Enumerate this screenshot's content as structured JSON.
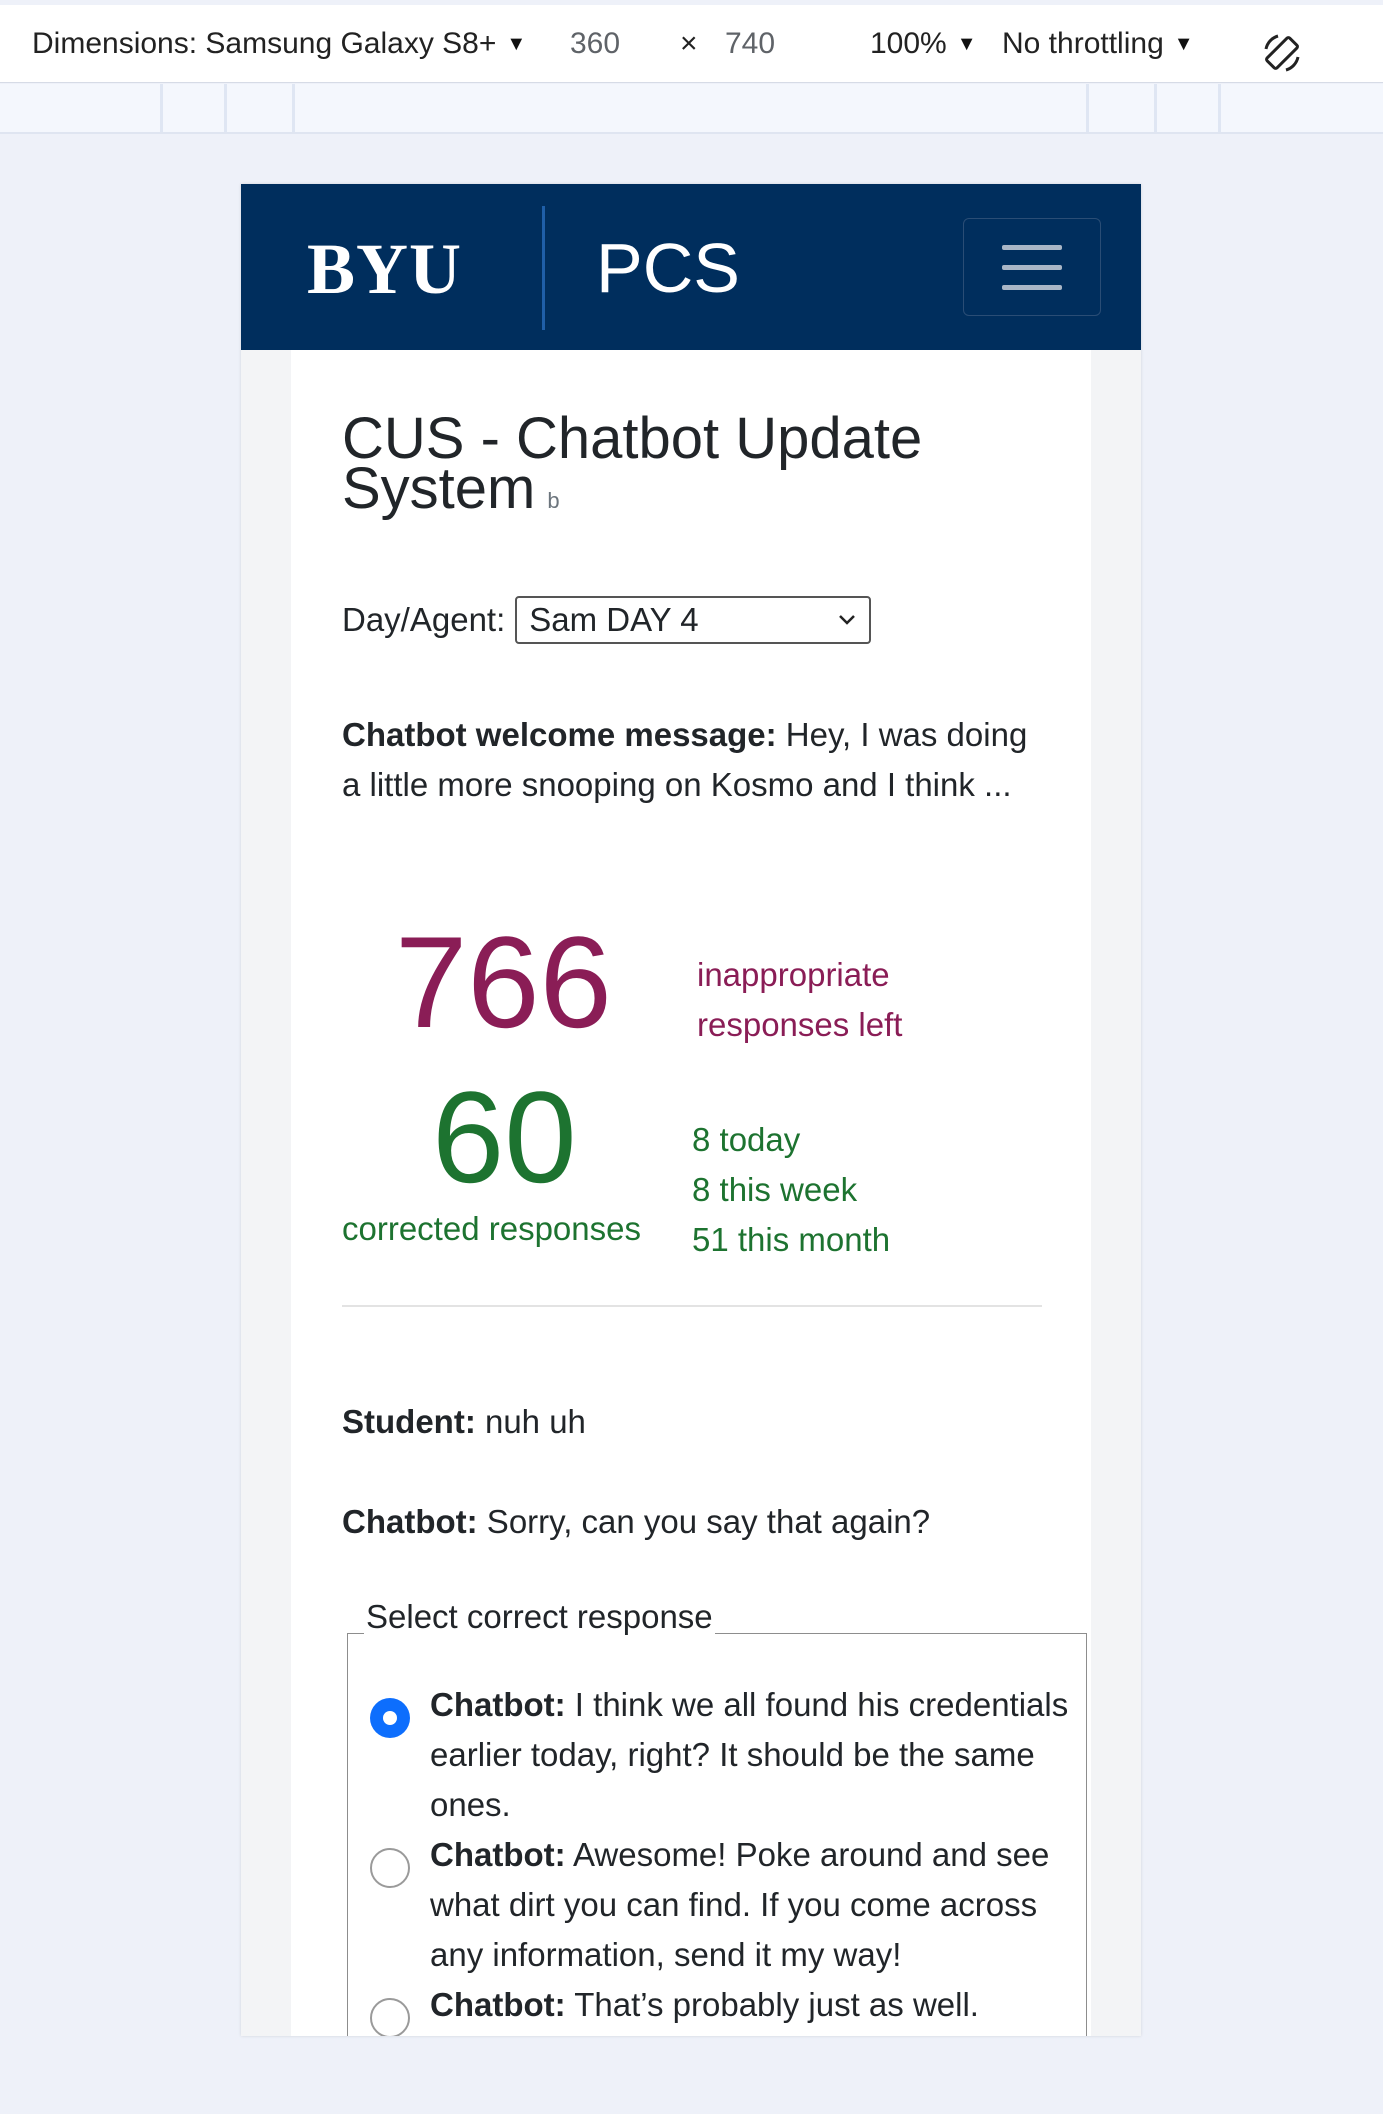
{
  "devtools": {
    "dimensions_label": "Dimensions: Samsung Galaxy S8+",
    "width": "360",
    "times": "×",
    "height": "740",
    "zoom": "100%",
    "throttling": "No throttling",
    "rotate_icon": "rotate-icon"
  },
  "navbar": {
    "logo": "BYU",
    "brand": "PCS",
    "menu_icon": "hamburger-icon"
  },
  "page": {
    "title": "CUS - Chatbot Update System",
    "version": "b",
    "day_agent_label": "Day/Agent:",
    "day_agent_selected": "Sam DAY 4",
    "welcome_label": "Chatbot welcome message:",
    "welcome_text": " Hey, I was doing a little more snooping on Kosmo and I think ...",
    "inappropriate_count": "766",
    "inappropriate_label": "inappropriate responses left",
    "corrected_count": "60",
    "corrected_label": "corrected responses",
    "stats": {
      "today": "8 today",
      "week": "8 this week",
      "month": "51 this month"
    },
    "student_label": "Student:",
    "student_text": " nuh uh",
    "chatbot_label": "Chatbot:",
    "chatbot_text": " Sorry, can you say that again?",
    "fieldset_legend": "Select correct response",
    "options": [
      {
        "label": "Chatbot:",
        "text": " I think we all found his credentials earlier today, right? It should be the same ones.",
        "checked": true
      },
      {
        "label": "Chatbot:",
        "text": " Awesome! Poke around and see what dirt you can find. If you come across any information, send it my way!",
        "checked": false
      },
      {
        "label": "Chatbot:",
        "text": " That’s probably just as well.",
        "checked": false
      }
    ]
  },
  "colors": {
    "navbar": "#002e5d",
    "inappropriate": "#8a1d56",
    "corrected": "#1d7330",
    "radio_checked": "#0d6efd"
  }
}
